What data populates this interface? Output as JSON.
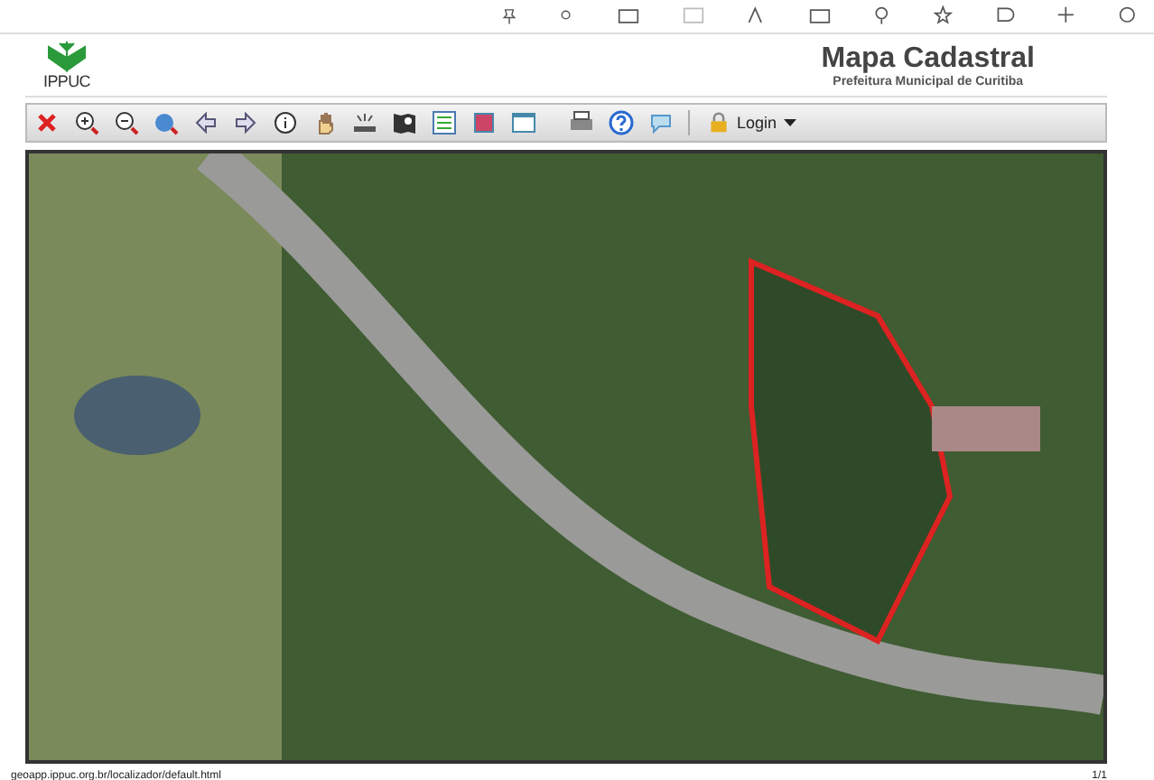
{
  "header": {
    "logo_text": "IPPUC",
    "title": "Mapa Cadastral",
    "subtitle": "Prefeitura Municipal de Curitiba"
  },
  "toolbar": {
    "login": {
      "label": "Login"
    }
  },
  "footer": {
    "url": "geoapp.ippuc.org.br/localizador/default.html",
    "page": "1/1"
  }
}
